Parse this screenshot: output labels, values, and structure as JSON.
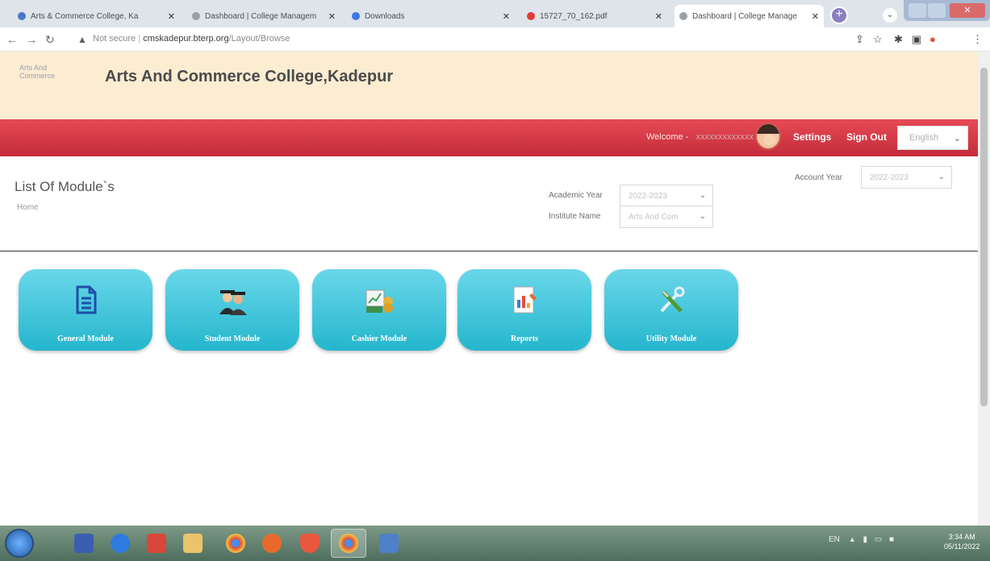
{
  "browser": {
    "tabs": [
      {
        "title": "Arts & Commerce College, Ka",
        "favicon_color": "#4a76c7"
      },
      {
        "title": "Dashboard | College Managem",
        "favicon_color": "#9aa0a6"
      },
      {
        "title": "Downloads",
        "favicon_color": "#3b78e7"
      },
      {
        "title": "15727_70_162.pdf",
        "favicon_color": "#e53935"
      },
      {
        "title": "Dashboard | College Manage",
        "favicon_color": "#9aa0a6"
      }
    ],
    "new_tab_symbol": "+",
    "address": {
      "security_label": "Not secure",
      "host": "cmskadepur.bterp.org",
      "path": "/Layout/Browse"
    }
  },
  "header": {
    "logo_alt": "Arts And Commerce",
    "title": "Arts And Commerce College,Kadepur"
  },
  "navbar": {
    "welcome_label": "Welcome -",
    "user_name": "xxxxxxxxxxxxx",
    "settings_label": "Settings",
    "signout_label": "Sign Out",
    "language": "English"
  },
  "page": {
    "title": "List Of Module`s",
    "breadcrumb": "Home",
    "filters": {
      "academic_year_label": "Academic Year",
      "academic_year_value": "2022-2023",
      "institute_label": "Institute Name",
      "institute_value": "Arts And Com",
      "account_year_label": "Account Year",
      "account_year_value": "2022-2023"
    }
  },
  "modules": [
    {
      "label": "General Module",
      "icon": "document-icon"
    },
    {
      "label": "Student Module",
      "icon": "graduates-icon"
    },
    {
      "label": "Cashier Module",
      "icon": "cashier-icon"
    },
    {
      "label": "Reports",
      "icon": "reports-icon"
    },
    {
      "label": "Utility Module",
      "icon": "tools-icon"
    }
  ],
  "taskbar": {
    "lang": "EN",
    "time": "3:34 AM",
    "date": "05/11/2022"
  },
  "colors": {
    "header_bg": "#fcedd2",
    "nav_red": "#d63a46",
    "tile_cyan": "#2fbcd2"
  }
}
